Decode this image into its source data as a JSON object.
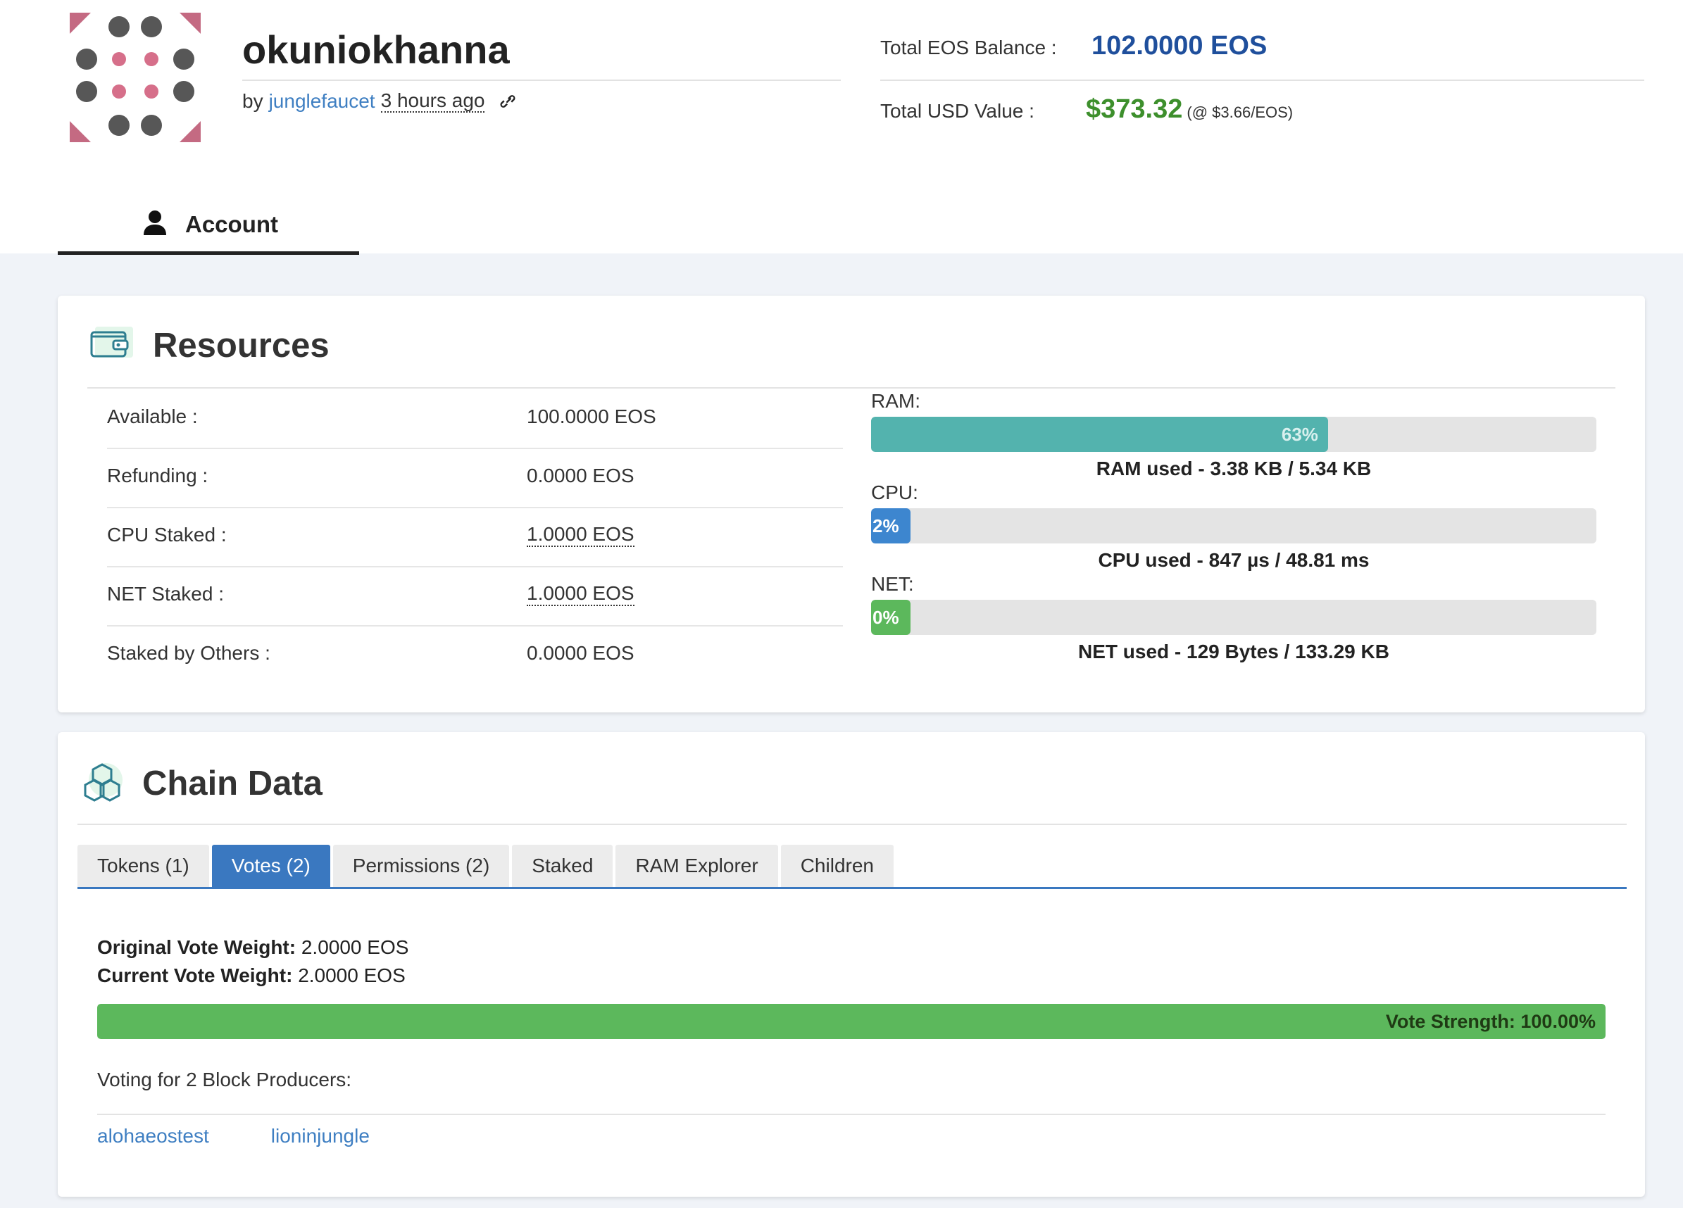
{
  "account": {
    "name": "okuniokhanna",
    "by_prefix": "by",
    "creator": "junglefaucet",
    "created_ago": "3 hours ago",
    "link_icon": "chain-link-icon",
    "avatar_icon": "identicon"
  },
  "balance": {
    "total_eos_label": "Total EOS Balance :",
    "total_eos_value": "102.0000 EOS",
    "total_usd_label": "Total USD Value :",
    "total_usd_value": "$373.32",
    "usd_rate": "(@ $3.66/EOS)"
  },
  "nav": {
    "account_tab": "Account",
    "account_icon": "user-icon"
  },
  "resources": {
    "title": "Resources",
    "icon": "wallet-icon",
    "rows": [
      {
        "label": "Available :",
        "value": "100.0000 EOS"
      },
      {
        "label": "Refunding :",
        "value": "0.0000 EOS"
      },
      {
        "label": "CPU Staked :",
        "value": "1.0000 EOS"
      },
      {
        "label": "NET Staked :",
        "value": "1.0000 EOS"
      },
      {
        "label": "Staked by Others :",
        "value": "0.0000 EOS"
      }
    ],
    "meters": {
      "ram": {
        "label": "RAM:",
        "percent": 63,
        "percent_text": "63%",
        "caption": "RAM used - 3.38 KB / 5.34 KB",
        "color": "#53b3ae"
      },
      "cpu": {
        "label": "CPU:",
        "percent": 2,
        "percent_text": "2%",
        "caption": "CPU used - 847 µs / 48.81 ms",
        "color": "#3d86cf"
      },
      "net": {
        "label": "NET:",
        "percent": 0,
        "percent_text": "0%",
        "caption": "NET used - 129 Bytes / 133.29 KB",
        "color": "#5cb85c"
      }
    }
  },
  "chain": {
    "title": "Chain Data",
    "icon": "cubes-icon",
    "tabs": [
      {
        "label": "Tokens (1)",
        "active": false
      },
      {
        "label": "Votes (2)",
        "active": true
      },
      {
        "label": "Permissions (2)",
        "active": false
      },
      {
        "label": "Staked",
        "active": false
      },
      {
        "label": "RAM Explorer",
        "active": false
      },
      {
        "label": "Children",
        "active": false
      }
    ],
    "votes": {
      "original_label": "Original Vote Weight:",
      "original_value": "2.0000 EOS",
      "current_label": "Current Vote Weight:",
      "current_value": "2.0000 EOS",
      "strength_percent": 100,
      "strength_text": "Vote Strength: 100.00%",
      "voting_for": "Voting for 2 Block Producers:",
      "producers": [
        "alohaeostest",
        "lioninjungle"
      ]
    }
  },
  "colors": {
    "accent_blue": "#3a78c0",
    "link_blue": "#3f7fc2",
    "eos_blue": "#1f4f9c",
    "usd_green": "#3d8f2c",
    "vote_green": "#5cb85c"
  }
}
